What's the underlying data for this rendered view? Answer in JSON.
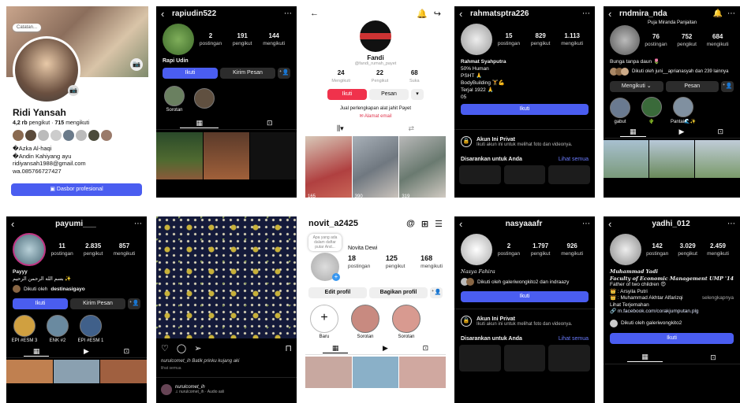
{
  "p1": {
    "note": "Catatan...",
    "name": "Ridi Yansah",
    "followers": "4,2 rb",
    "followers_label": "pengikut",
    "dot": "·",
    "following": "715",
    "following_label": "mengikuti",
    "bio": [
      "�Azka Al-haqi",
      "�Andin Kahiyang ayu",
      "ridiyansah1988@gmail.com",
      "wa.085766727427"
    ],
    "dashboard": "Dasbor profesional"
  },
  "p2": {
    "username": "rapiudin522",
    "posts": "2",
    "posts_label": "postingan",
    "followers": "191",
    "followers_label": "pengikut",
    "following": "144",
    "following_label": "mengikuti",
    "name": "Rapi Udin",
    "follow": "Ikuti",
    "message": "Kirim Pesan",
    "highlight": "Sorotan"
  },
  "p3": {
    "name": "Fandi",
    "handle": "@fandi_rumah_payet",
    "posts": "24",
    "posts_label": "Mengikuti",
    "followers": "22",
    "followers_label": "Pengikut",
    "likes": "68",
    "likes_label": "Suka",
    "follow": "Ikuti",
    "message": "Pesan",
    "bio": "Jual perlengkapan alat jahit Payet",
    "email": "Alamat email",
    "views": [
      "165",
      "390",
      "319"
    ]
  },
  "p4": {
    "username": "rahmatsptra226",
    "posts": "15",
    "posts_label": "postingan",
    "followers": "829",
    "followers_label": "pengikut",
    "following": "1.113",
    "following_label": "mengikuti",
    "bio": [
      "Rahmat Syahputra",
      "50% Human",
      "PSHT 🙏",
      "BodyBuilding 🏋💪",
      "Terjal 1922 🙏",
      "05"
    ],
    "follow": "Ikuti",
    "private_title": "Akun Ini Privat",
    "private_sub": "Ikuti akun ini untuk melihat foto dan videonya.",
    "suggest": "Disarankan untuk Anda",
    "see_all": "Lihat semua"
  },
  "p5": {
    "username": "rndmira_nda",
    "posts": "76",
    "posts_label": "postingan",
    "followers": "752",
    "followers_label": "pengikut",
    "following": "684",
    "following_label": "mengikuti",
    "name": "Puja Miranda Panjaitan",
    "bio": "Bunga tanpa daun 🌷",
    "followed_by": "Dikuti oleh juni__aprianasyah dan 239 lainnya",
    "following_btn": "Mengikuti",
    "message": "Pesan",
    "highlights": [
      "gabut",
      "🌵",
      "Pantai🌊✨"
    ]
  },
  "p6": {
    "username": "payumi___",
    "posts": "11",
    "posts_label": "postingan",
    "followers": "2.835",
    "followers_label": "pengikut",
    "following": "857",
    "following_label": "mengikuti",
    "name": "Payyy",
    "bio": "بسم الله الرحمن الرحيم ✨",
    "followed_by": "Dikuti oleh",
    "followed_name": "destinasigayo",
    "follow": "Ikuti",
    "message": "Kirim Pesan",
    "highlights": [
      "EPI #ESM 3",
      "ENK #2",
      "EPI #ESM 1"
    ]
  },
  "p7": {
    "caption": "nurulcomet_ih Batik prinku kujang aki",
    "sub": "lihat semua",
    "user": "nurulcomet_ih",
    "music": "♫ nurulcomet_ih · Audio asli"
  },
  "p8": {
    "username": "novit_a2425",
    "note": "Apa yang ada dalam daftar putar And...",
    "name": "Novita Dewi",
    "posts": "18",
    "posts_label": "postingan",
    "followers": "125",
    "followers_label": "pengikut",
    "following": "168",
    "following_label": "mengikuti",
    "edit": "Edit profil",
    "share": "Bagikan profil",
    "new": "Baru",
    "highlights": [
      "Sorotan",
      "Sorotan"
    ]
  },
  "p9": {
    "username": "nasyaaafr",
    "posts": "2",
    "posts_label": "postingan",
    "followers": "1.797",
    "followers_label": "pengikut",
    "following": "926",
    "following_label": "mengikuti",
    "name": "Nasya Fahira",
    "followed_by": "Dikuti oleh galeriwongkito2 dan indraazy",
    "follow": "Ikuti",
    "private_title": "Akun Ini Privat",
    "private_sub": "Ikuti akun ini untuk melihat foto dan videonya.",
    "suggest": "Disarankan untuk Anda",
    "see_all": "Lihat semua"
  },
  "p10": {
    "username": "yadhi_012",
    "posts": "142",
    "posts_label": "postingan",
    "followers": "3.029",
    "followers_label": "pengikut",
    "following": "2.459",
    "following_label": "mengikuti",
    "bio": [
      "Muhammad Yadi",
      "Faculty of Economic Management UMP '14",
      "Father of two children 😍",
      "👑 : Arsyila Putri",
      "👑 : Muhammad Akhtar Alfarizqi",
      "Lihat Terjemahan"
    ],
    "seeall": "selengkapnya",
    "link": "m.facebook.com/corakjumputan.plg",
    "followed_by": "Dikuti oleh galeriwongkito2",
    "follow": "Ikuti"
  }
}
